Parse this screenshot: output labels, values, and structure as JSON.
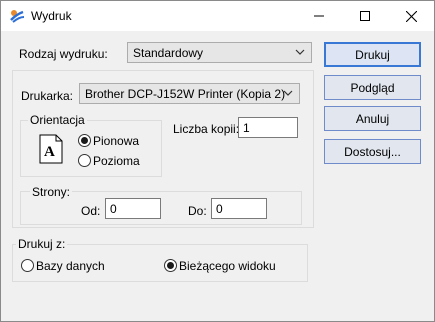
{
  "window": {
    "title": "Wydruk",
    "title_bar_bg": "#ffffff",
    "accent": "#3a78d6"
  },
  "report_type": {
    "label": "Rodzaj wydruku:",
    "value": "Standardowy"
  },
  "printer": {
    "label": "Drukarka:",
    "value": "Brother DCP-J152W Printer (Kopia 2)"
  },
  "orientation": {
    "legend": "Orientacja",
    "options": [
      {
        "label": "Pionowa",
        "selected": true
      },
      {
        "label": "Pozioma",
        "selected": false
      }
    ]
  },
  "copies": {
    "label": "Liczba kopii:",
    "value": "1"
  },
  "pages": {
    "legend": "Strony:",
    "from_label": "Od:",
    "from_value": "0",
    "to_label": "Do:",
    "to_value": "0"
  },
  "print_from": {
    "legend": "Drukuj z:",
    "options": [
      {
        "label": "Bazy danych",
        "selected": false
      },
      {
        "label": "Bieżącego widoku",
        "selected": true
      }
    ]
  },
  "buttons": {
    "print": "Drukuj",
    "preview": "Podgląd",
    "cancel": "Anuluj",
    "customize": "Dostosuj..."
  }
}
